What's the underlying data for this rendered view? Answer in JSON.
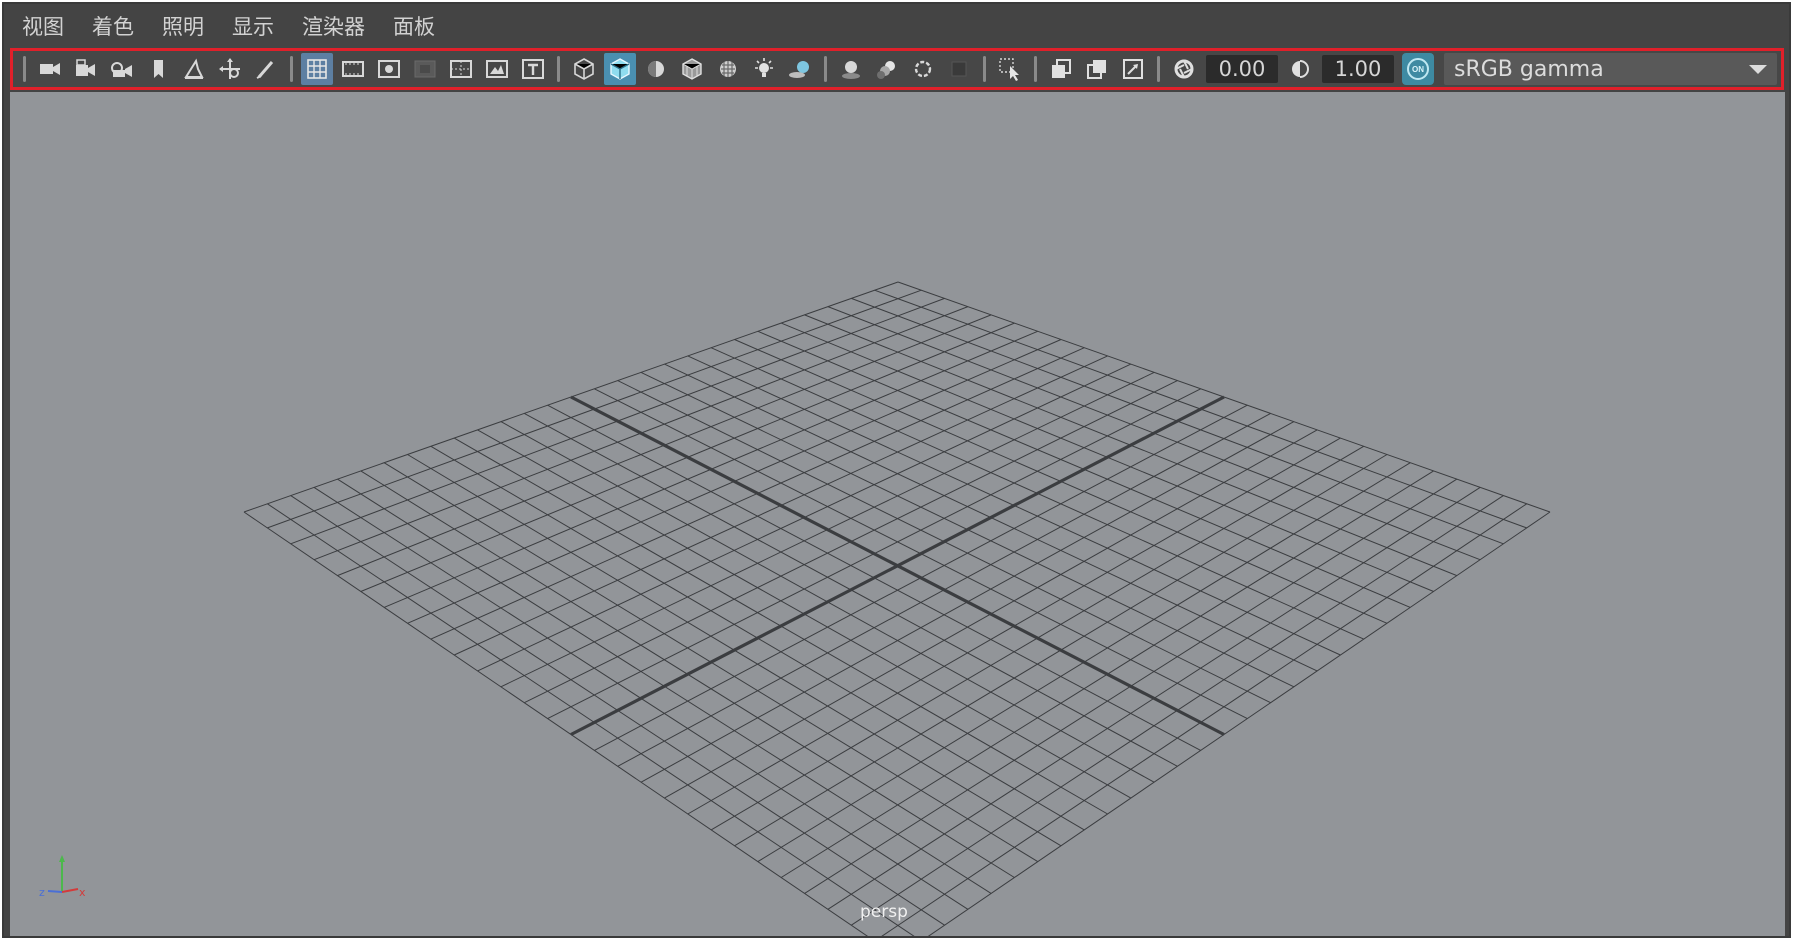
{
  "menu": [
    "视图",
    "着色",
    "照明",
    "显示",
    "渲染器",
    "面板"
  ],
  "toolbar": {
    "groups": [
      [
        "camera-icon",
        "camera-attributes-icon",
        "camera-lock-icon",
        "bookmark-icon",
        "image-plane-icon",
        "2d-pan-zoom-icon",
        "grease-pencil-icon"
      ],
      [
        "grid-icon",
        "film-gate-icon",
        "resolution-gate-icon",
        "gate-mask-icon",
        "field-chart-icon",
        "safe-action-icon",
        "safe-title-icon"
      ],
      [
        "wireframe-icon",
        "smooth-shade-icon",
        "use-default-material-icon",
        "wireframe-on-shaded-icon",
        "textured-icon",
        "lighting-icon",
        "shadows-icon"
      ],
      [
        "screen-space-ao-icon",
        "motion-blur-icon",
        "multisample-aa-icon",
        "depth-of-field-icon"
      ],
      [
        "isolate-select-icon"
      ],
      [
        "xray-icon",
        "xray-active-components-icon",
        "xray-joints-icon"
      ]
    ],
    "exposure_icon": "exposure-icon",
    "exposure_value": "0.00",
    "gamma_icon": "gamma-icon",
    "gamma_value": "1.00",
    "color_management_label": "ON",
    "colorspace_value": "sRGB gamma"
  },
  "viewport": {
    "camera_label": "persp",
    "background_color": "#929599",
    "grid_color": "#3b3d40"
  },
  "axis": {
    "x": "x",
    "y": "y",
    "z": "z"
  }
}
